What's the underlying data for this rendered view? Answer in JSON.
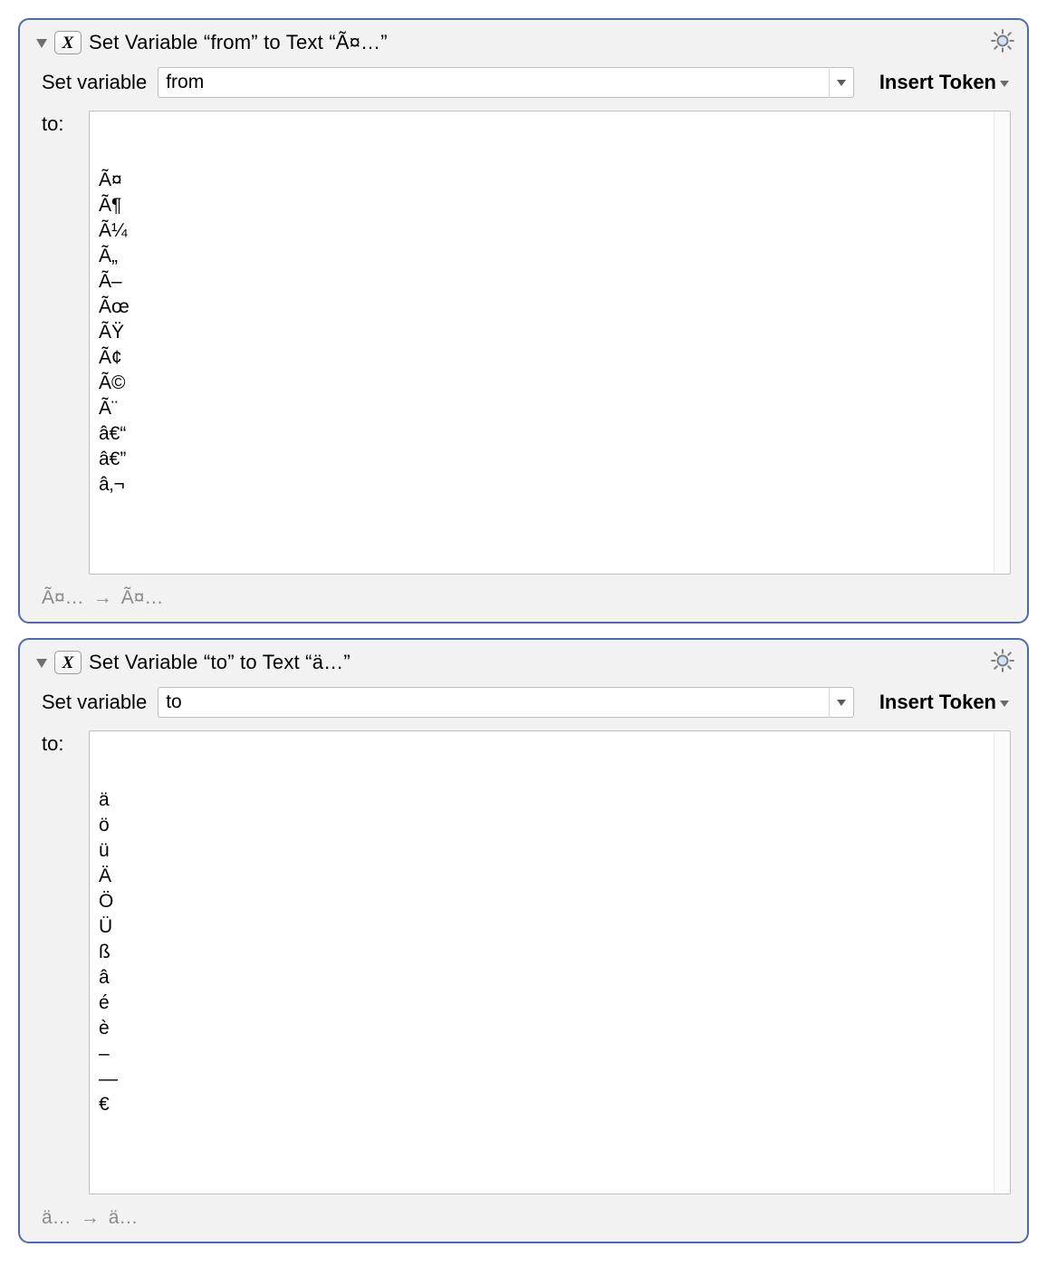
{
  "badge_glyph": "X",
  "actions": [
    {
      "title": "Set Variable “from” to Text “Ã¤…”",
      "set_variable_label": "Set variable",
      "variable_name": "from",
      "insert_token_label": "Insert Token",
      "to_label": "to:",
      "text_value": "Ã¤\nÃ¶\nÃ¼\nÃ„\nÃ–\nÃœ\nÃŸ\nÃ¢\nÃ©\nÃ¨\nâ€“\nâ€”\nâ‚¬",
      "footer_left": "Ã¤…",
      "footer_arrow": "→",
      "footer_right": "Ã¤…"
    },
    {
      "title": "Set Variable “to” to Text “ä…”",
      "set_variable_label": "Set variable",
      "variable_name": "to",
      "insert_token_label": "Insert Token",
      "to_label": "to:",
      "text_value": "ä\nö\nü\nÄ\nÖ\nÜ\nß\nâ\né\nè\n–\n—\n€",
      "footer_left": "ä…",
      "footer_arrow": "→",
      "footer_right": "ä…"
    }
  ]
}
